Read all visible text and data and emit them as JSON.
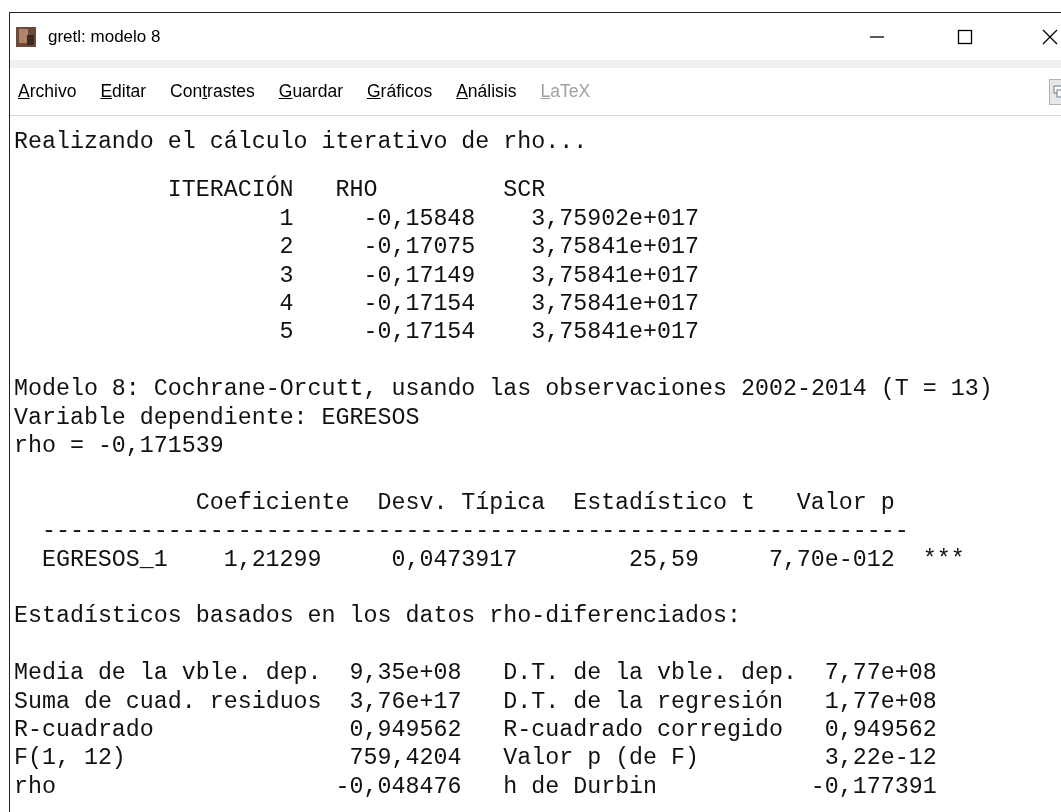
{
  "window": {
    "title": "gretl: modelo 8"
  },
  "menu": [
    {
      "key": "A",
      "post": "rchivo",
      "disabled": false
    },
    {
      "key": "E",
      "post": "ditar",
      "disabled": false
    },
    {
      "pre": "Con",
      "key": "t",
      "post": "rastes",
      "disabled": false
    },
    {
      "key": "G",
      "post": "uardar",
      "disabled": false
    },
    {
      "key": "G",
      "post": "ráficos",
      "disabled": false
    },
    {
      "key": "A",
      "post": "nálisis",
      "disabled": false
    },
    {
      "key": "L",
      "post": "aTeX",
      "disabled": true
    }
  ],
  "output": {
    "intro": "Realizando el cálculo iterativo de rho...",
    "iterations": {
      "columns": [
        "ITERACIÓN",
        "RHO",
        "SCR"
      ],
      "rows": [
        [
          "1",
          "-0,15848",
          "3,75902e+017"
        ],
        [
          "2",
          "-0,17075",
          "3,75841e+017"
        ],
        [
          "3",
          "-0,17149",
          "3,75841e+017"
        ],
        [
          "4",
          "-0,17154",
          "3,75841e+017"
        ],
        [
          "5",
          "-0,17154",
          "3,75841e+017"
        ]
      ]
    },
    "model_lines": [
      "Modelo 8: Cochrane-Orcutt, usando las observaciones 2002-2014 (T = 13)",
      "Variable dependiente: EGRESOS",
      "rho = -0,171539"
    ],
    "coefficients": {
      "columns": [
        "Coeficiente",
        "Desv. Típica",
        "Estadístico t",
        "Valor p"
      ],
      "rule": "--------------------------------------------------------------",
      "rows": [
        {
          "name": "EGRESOS_1",
          "values": [
            "1,21299",
            "0,0473917",
            "25,59",
            "7,70e-012"
          ],
          "significance": "***"
        }
      ]
    },
    "stats_title": "Estadísticos basados en los datos rho-diferenciados:",
    "stats": [
      {
        "label": "Media de la vble. dep.",
        "value": "9,35e+08",
        "label_2": "D.T. de la vble. dep.",
        "value_2": "7,77e+08"
      },
      {
        "label": "Suma de cuad. residuos",
        "value": "3,76e+17",
        "label_2": "D.T. de la regresión",
        "value_2": "1,77e+08"
      },
      {
        "label": "R-cuadrado",
        "value": "0,949562",
        "label_2": "R-cuadrado corregido",
        "value_2": "0,949562"
      },
      {
        "label": "F(1, 12)",
        "value": "759,4204",
        "label_2": "Valor p (de F)",
        "value_2": "3,22e-12"
      },
      {
        "label": "rho",
        "value": "-0,048476",
        "label_2": "h de Durbin",
        "value_2": "-0,177391"
      }
    ]
  }
}
